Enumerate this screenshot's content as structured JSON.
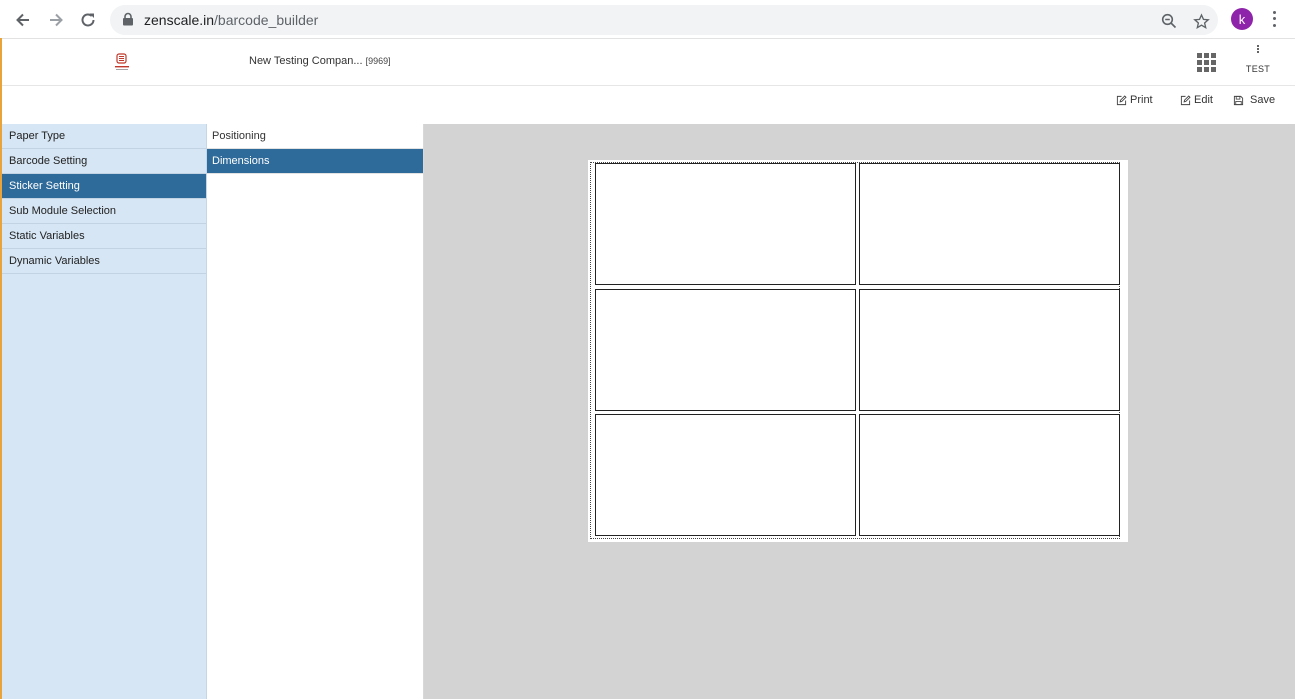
{
  "browser": {
    "url_domain": "zenscale.in",
    "url_path": "/barcode_builder",
    "profile_initial": "k"
  },
  "header": {
    "company_name": "New Testing Compan...",
    "company_code": "[9969]",
    "user_label": "TEST"
  },
  "toolbar": {
    "print_label": "Print",
    "edit_label": "Edit",
    "save_label": "Save"
  },
  "sidebar": {
    "items": [
      {
        "label": "Paper Type"
      },
      {
        "label": "Barcode Setting"
      },
      {
        "label": "Sticker Setting"
      },
      {
        "label": "Sub Module Selection"
      },
      {
        "label": "Static Variables"
      },
      {
        "label": "Dynamic Variables"
      }
    ],
    "active_index": 2
  },
  "subpanel": {
    "items": [
      {
        "label": "Positioning"
      },
      {
        "label": "Dimensions"
      }
    ],
    "active_index": 1
  },
  "canvas": {
    "sticker_rows": 3,
    "sticker_cols": 2
  },
  "colors": {
    "accent": "#2f6b9a",
    "sidebar_bg": "#d6e6f4",
    "canvas_bg": "#d3d3d3",
    "profile": "#8e24aa"
  }
}
